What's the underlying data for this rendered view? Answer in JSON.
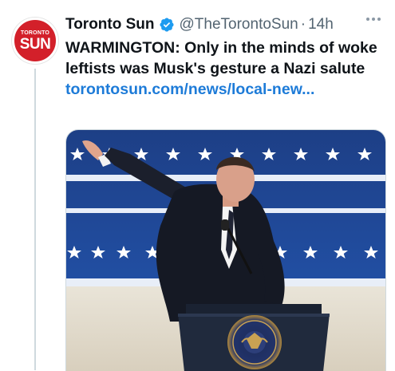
{
  "tweet": {
    "display_name": "Toronto Sun",
    "handle": "@TheTorontoSun",
    "separator": "·",
    "time": "14h",
    "headline": "WARMINGTON: Only in the minds of woke leftists was Musk's gesture a Nazi salute",
    "link": "torontosun.com/news/local-new..."
  },
  "avatar": {
    "top_text": "TORONTO",
    "main_text": "SUN",
    "color": "#d3202a"
  },
  "media": {
    "seal_text": "PRESIDENT OF THE UNITED STATES"
  },
  "colors": {
    "link": "#1d7bd8",
    "secondary_text": "#536471",
    "verified": "#1d9bf0",
    "backdrop_blue": "#1f4fa6"
  },
  "icons": {
    "verified": "verified-badge-icon",
    "more": "more-options-icon"
  }
}
